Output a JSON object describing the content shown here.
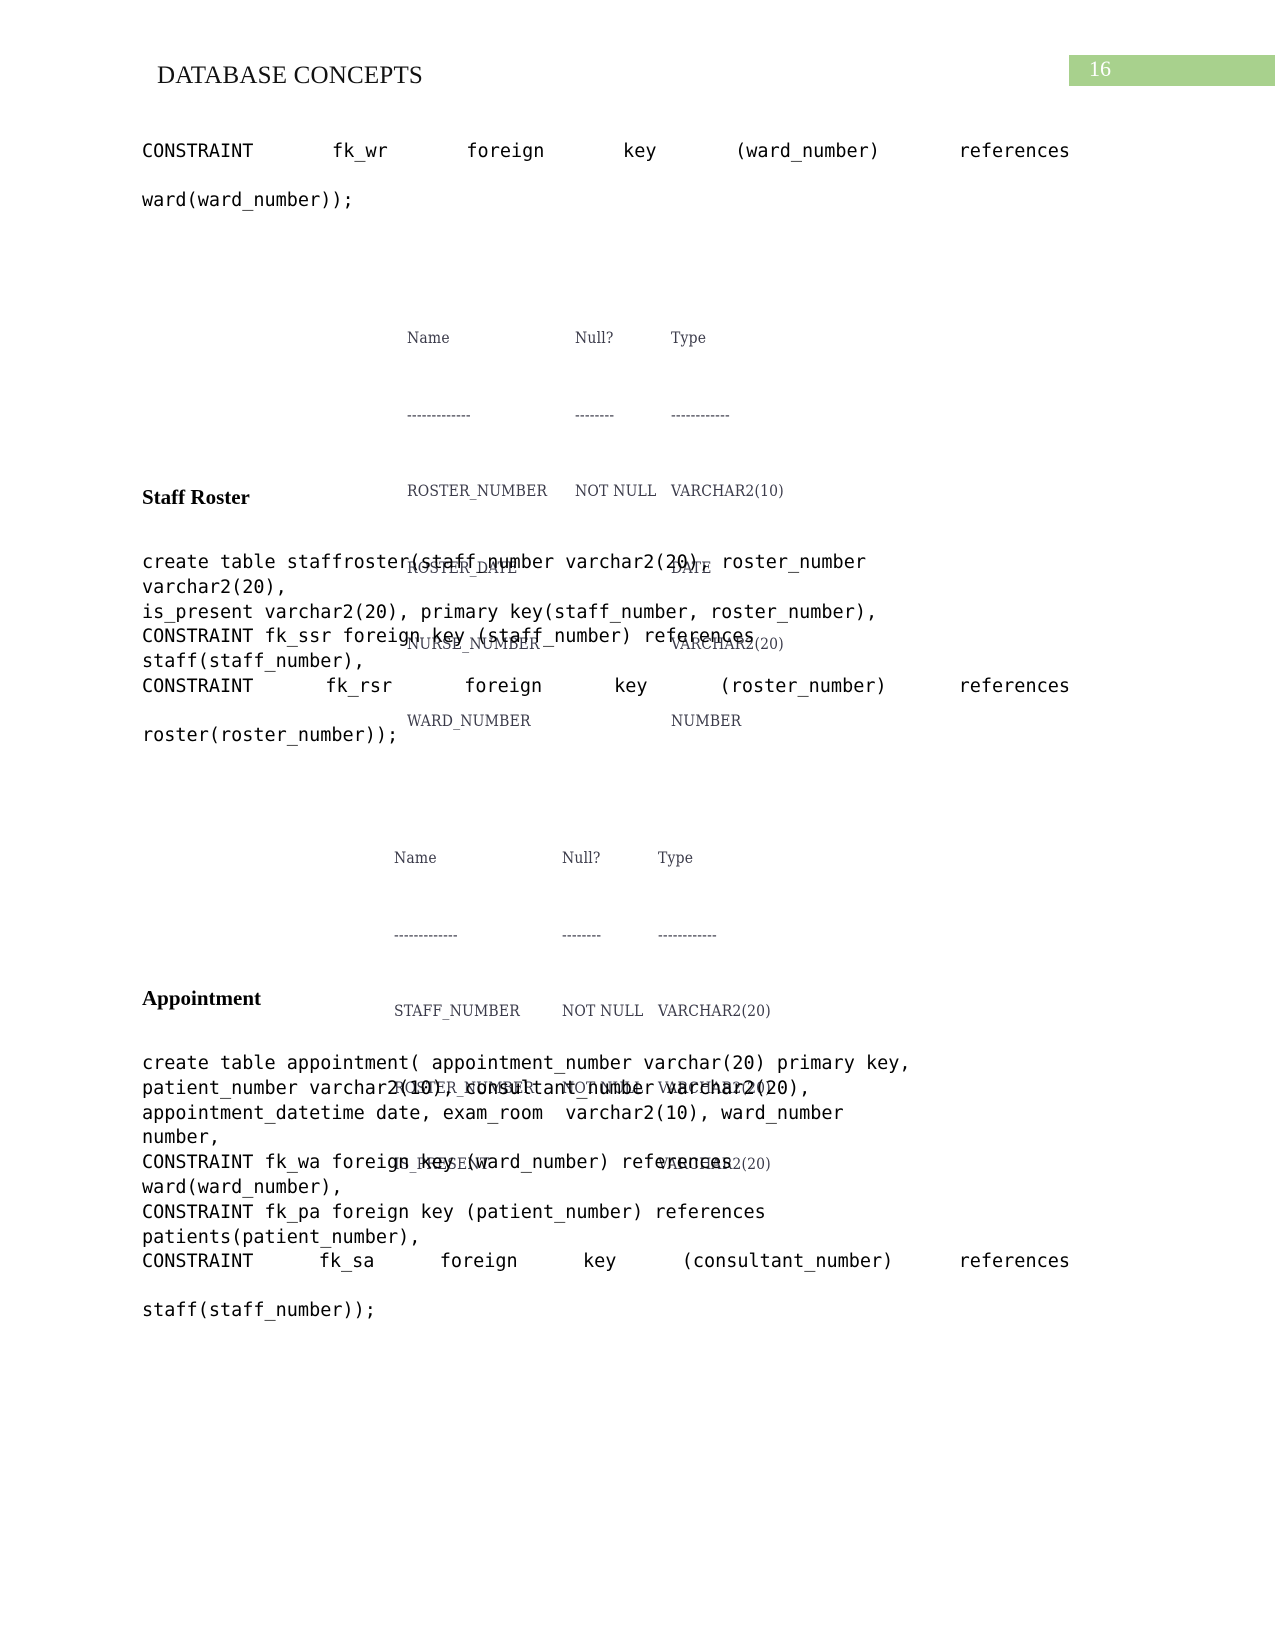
{
  "header": {
    "title": "DATABASE CONCEPTS",
    "page_number": "16",
    "badge_color": "#a8d18d"
  },
  "blocks": {
    "code1": {
      "line1": "CONSTRAINT fk_wr foreign key (ward_number) references",
      "line2": "ward(ward_number));"
    },
    "heading_staff_roster": "Staff Roster",
    "code2": {
      "line1": "create table staffroster(staff_number varchar2(20), roster_number",
      "line2": "varchar2(20),",
      "line3": "is_present varchar2(20), primary key(staff_number, roster_number),",
      "line4": "CONSTRAINT fk_ssr foreign key (staff_number) references",
      "line5": "staff(staff_number),",
      "line6": "CONSTRAINT fk_rsr foreign key (roster_number) references",
      "line7": "roster(roster_number));"
    },
    "heading_appointment": "Appointment",
    "code3": {
      "line1": "create table appointment( appointment_number varchar(20) primary key,",
      "line2": "patient_number varchar2(10), consultant_number varchar2(20),",
      "line3": "appointment_datetime date, exam_room  varchar2(10), ward_number",
      "line4": "number,",
      "line5": "CONSTRAINT fk_wa foreign key (ward_number) references",
      "line6": "ward(ward_number),",
      "line7": "CONSTRAINT fk_pa foreign key (patient_number) references",
      "line8": "patients(patient_number),",
      "line9": "CONSTRAINT fk_sa foreign key (consultant_number) references",
      "line10": "staff(staff_number));"
    }
  },
  "desc_tables": [
    {
      "title": "roster-describe-output",
      "headers": {
        "name": "Name",
        "null": "Null?",
        "type": "Type"
      },
      "separators": {
        "name": "-------------",
        "null": "--------",
        "type": "------------"
      },
      "rows": [
        {
          "name": "ROSTER_NUMBER",
          "null": "NOT NULL",
          "type": "VARCHAR2(10)"
        },
        {
          "name": "ROSTER_DATE",
          "null": "",
          "type": "DATE"
        },
        {
          "name": "NURSE_NUMBER",
          "null": "",
          "type": "VARCHAR2(20)"
        },
        {
          "name": "WARD_NUMBER",
          "null": "",
          "type": "NUMBER"
        }
      ]
    },
    {
      "title": "staffroster-describe-output",
      "headers": {
        "name": "Name",
        "null": "Null?",
        "type": "Type"
      },
      "separators": {
        "name": "-------------",
        "null": "--------",
        "type": "------------"
      },
      "rows": [
        {
          "name": "STAFF_NUMBER",
          "null": "NOT NULL",
          "type": "VARCHAR2(20)"
        },
        {
          "name": "ROSTER_NUMBER",
          "null": "NOT NULL",
          "type": "VARCHAR2(20)"
        },
        {
          "name": "IS_PRESENT",
          "null": "",
          "type": "VARCHAR2(20)"
        }
      ]
    }
  ]
}
